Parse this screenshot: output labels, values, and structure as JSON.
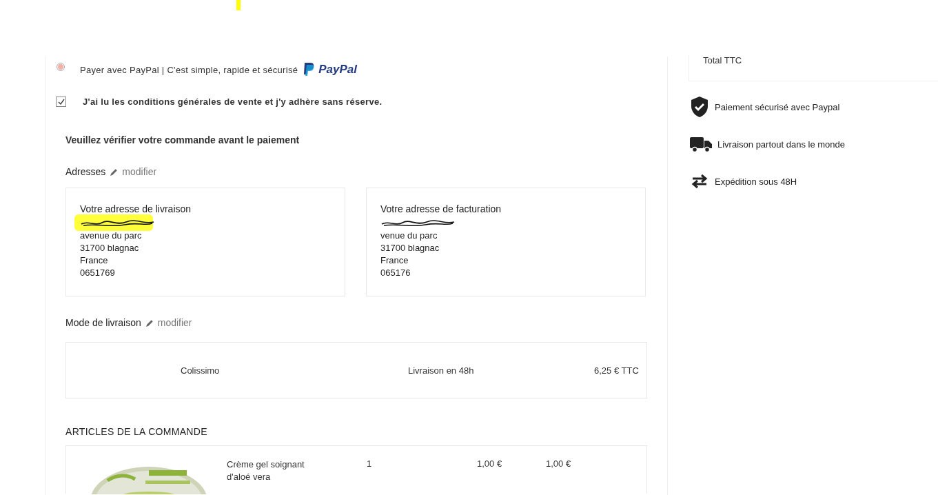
{
  "payment": {
    "label": "Payer avec PayPal | C'est simple, rapide et sécurisé",
    "selected": true,
    "logo": "PayPal"
  },
  "terms": {
    "label": "J'ai lu les conditions générales de vente et j'y adhère sans réserve.",
    "checked": true
  },
  "verify_title": "Veuillez vérifier votre commande avant le paiement",
  "addresses": {
    "title": "Adresses",
    "edit": "modifier",
    "cards": [
      {
        "title": "Votre adresse de livraison",
        "highlighted": true,
        "lines": [
          "avenue du parc",
          "31700 blagnac",
          "France",
          "0651769"
        ]
      },
      {
        "title": "Votre adresse de facturation",
        "highlighted": false,
        "lines": [
          "venue du parc",
          "31700 blagnac",
          "France",
          "065176"
        ]
      }
    ]
  },
  "delivery": {
    "title": "Mode de livraison",
    "edit": "modifier",
    "carrier": "Colissimo",
    "delay": "Livraison en 48h",
    "price": "6,25 € TTC"
  },
  "articles": {
    "title": "ARTICLES DE LA COMMANDE",
    "items": [
      {
        "name": "Crème gel soignant d'aloé vera",
        "quantity": "1",
        "unit_price": "1,00 €",
        "total": "1,00 €"
      }
    ]
  },
  "summary": {
    "total_label": "Total TTC"
  },
  "guarantees": [
    {
      "kind": "shield",
      "label": "Paiement sécurisé avec Paypal"
    },
    {
      "kind": "truck",
      "label": "Livraison partout dans le monde"
    },
    {
      "kind": "arrows",
      "label": "Expédition sous 48H"
    }
  ]
}
